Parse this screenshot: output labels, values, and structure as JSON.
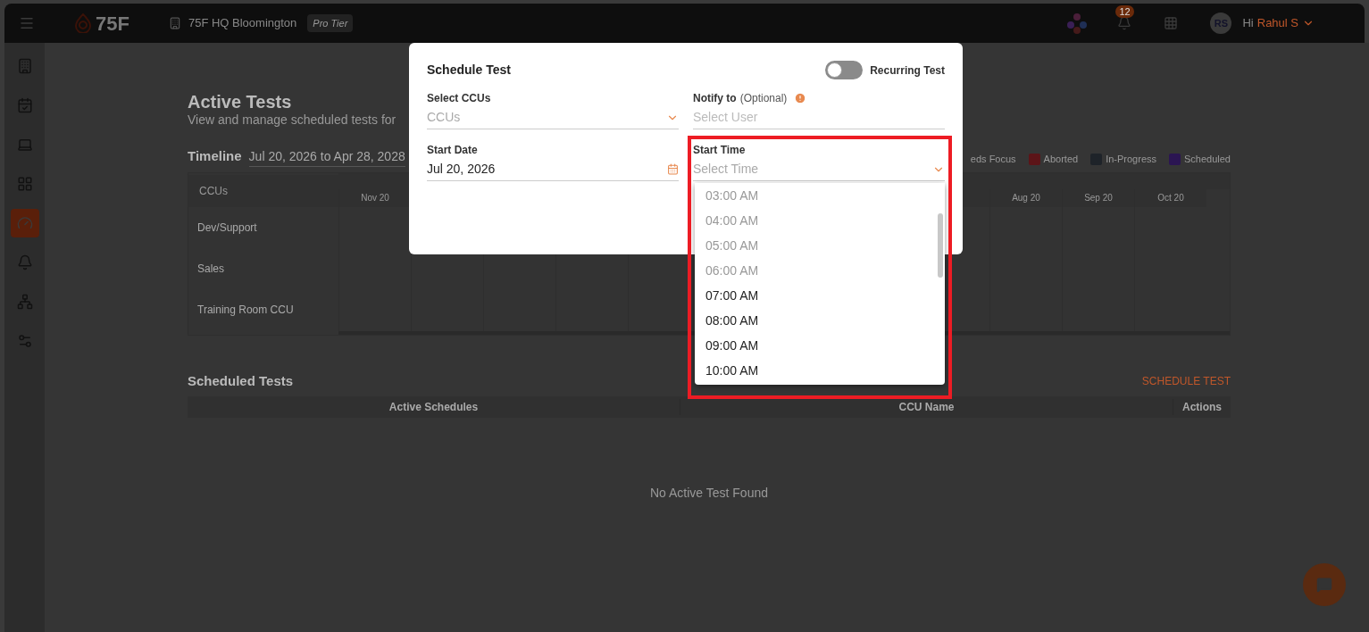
{
  "top_bar": {
    "logo": "75F",
    "building": "75F HQ Bloomington",
    "tier": "Pro Tier",
    "notifications": "12",
    "avatar": "RS",
    "greeting": "Hi",
    "user": "Rahul S"
  },
  "sidebar": {
    "items": [
      {
        "kind": "building",
        "selected": false
      },
      {
        "kind": "calendar",
        "selected": false
      },
      {
        "kind": "laptop",
        "selected": false
      },
      {
        "kind": "grid",
        "selected": false
      },
      {
        "kind": "gauge",
        "selected": true
      },
      {
        "kind": "bell",
        "selected": false
      },
      {
        "kind": "network",
        "selected": false
      },
      {
        "kind": "settings",
        "selected": false
      }
    ]
  },
  "page": {
    "title": "Active Tests",
    "subtitle": "View and manage scheduled tests for",
    "timeline": {
      "label": "Timeline",
      "range": "Jul 20, 2026 to Apr 28, 2028",
      "legend": [
        {
          "label": "eds Focus"
        },
        {
          "label": "Aborted",
          "color": "#5c1418"
        },
        {
          "label": "In-Progress",
          "color": "#1e2329"
        },
        {
          "label": "Scheduled",
          "color": "#2b1552"
        }
      ],
      "ccu_header": "CCUs",
      "months_left": [
        "Nov 20"
      ],
      "months_right": [
        "Aug 20",
        "Sep 20",
        "Oct 20"
      ],
      "rows": [
        "Dev/Support",
        "Sales",
        "Training Room CCU"
      ]
    },
    "scheduled": {
      "title": "Scheduled Tests",
      "action": "SCHEDULE TEST",
      "columns": [
        "Active Schedules",
        "CCU Name",
        "Actions"
      ],
      "empty": "No Active Test Found"
    }
  },
  "modal": {
    "title": "Schedule Test",
    "recurring": {
      "label": "Recurring Test",
      "on": false
    },
    "ccus": {
      "label": "Select CCUs",
      "placeholder": "CCUs"
    },
    "notify": {
      "label": "Notify to",
      "hint": "(Optional)",
      "placeholder": "Select User"
    },
    "start_date": {
      "label": "Start Date",
      "value": "Jul 20, 2026"
    },
    "start_time": {
      "label": "Start Time",
      "placeholder": "Select Time",
      "options": [
        {
          "label": "03:00 AM",
          "disabled": true
        },
        {
          "label": "04:00 AM",
          "disabled": true
        },
        {
          "label": "05:00 AM",
          "disabled": true
        },
        {
          "label": "06:00 AM",
          "disabled": true
        },
        {
          "label": "07:00 AM",
          "disabled": false
        },
        {
          "label": "08:00 AM",
          "disabled": false
        },
        {
          "label": "09:00 AM",
          "disabled": false
        },
        {
          "label": "10:00 AM",
          "disabled": false
        }
      ]
    }
  }
}
